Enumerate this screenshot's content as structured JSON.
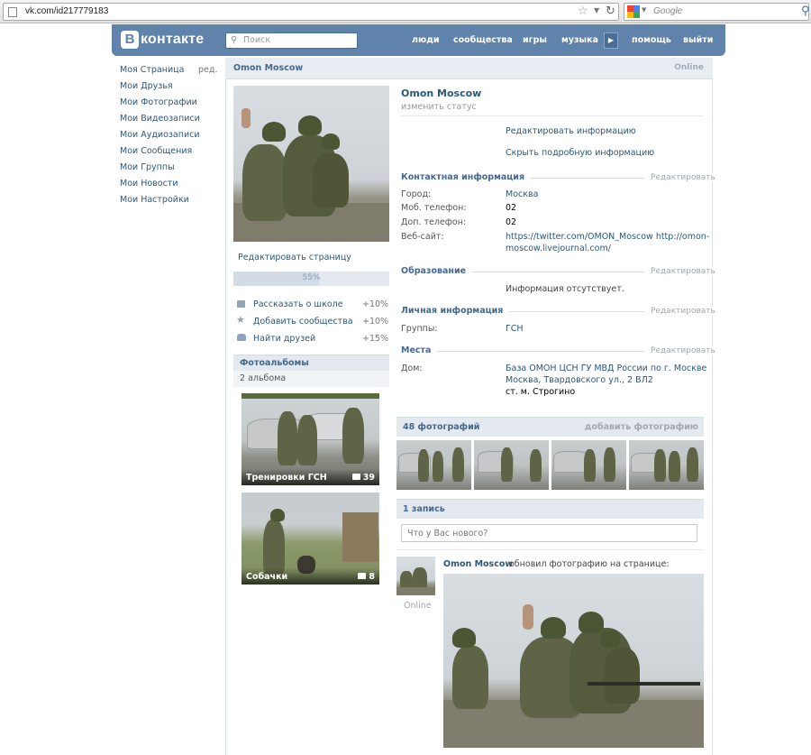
{
  "browser": {
    "url": "vk.com/id217779183",
    "search_placeholder": "Google"
  },
  "header": {
    "logo_letter": "В",
    "logo_text": "контакте",
    "search_placeholder": "Поиск",
    "nav": [
      "люди",
      "сообщества",
      "игры",
      "музыка",
      "помощь",
      "выйти"
    ]
  },
  "menu": {
    "edit_label": "ред.",
    "items": [
      "Моя Страница",
      "Мои Друзья",
      "Мои Фотографии",
      "Мои Видеозаписи",
      "Мои Аудиозаписи",
      "Мои Сообщения",
      "Мои Группы",
      "Мои Новости",
      "Мои Настройки"
    ]
  },
  "profile_bar": {
    "name": "Omon Moscow",
    "status": "Online"
  },
  "left_column": {
    "edit_page": "Редактировать страницу",
    "progress": {
      "value": 0.55,
      "label": "55%"
    },
    "suggestions": [
      {
        "icon": "school-icon",
        "label": "Рассказать о школе",
        "bonus": "+10%"
      },
      {
        "icon": "star-icon",
        "label": "Добавить сообщества",
        "bonus": "+10%"
      },
      {
        "icon": "friends-icon",
        "label": "Найти друзей",
        "bonus": "+15%"
      }
    ],
    "albums_title": "Фотоальбомы",
    "albums_count": "2 альбома",
    "albums": [
      {
        "title": "Тренировки ГСН",
        "count": "39"
      },
      {
        "title": "Собачки",
        "count": "8"
      }
    ]
  },
  "info": {
    "name": "Omon Moscow",
    "change_status": "изменить статус",
    "edit_info": "Редактировать информацию",
    "hide_info": "Скрыть подробную информацию",
    "edit_label": "Редактировать",
    "contacts": {
      "title": "Контактная информация",
      "rows": [
        {
          "label": "Город:",
          "value": "Москва"
        },
        {
          "label": "Моб. телефон:",
          "value": "02"
        },
        {
          "label": "Доп. телефон:",
          "value": "02"
        },
        {
          "label": "Веб-сайт:",
          "value_line1": "https://twitter.com/OMON_Moscow http://omon-",
          "value_line2": "moscow.livejournal.com/"
        }
      ]
    },
    "education": {
      "title": "Образование",
      "value": "Информация отсутствует."
    },
    "personal": {
      "title": "Личная информация",
      "label": "Группы:",
      "value": "ГСН"
    },
    "places": {
      "title": "Места",
      "label": "Дом:",
      "line1": "База ОМОН ЦСН ГУ МВД России по г. Москве",
      "line2": "Москва, Твардовского ул., 2 ВЛ2",
      "line3": "ст. м. Строгино"
    }
  },
  "photos": {
    "title": "48 фотографий",
    "add_label": "добавить фотографию"
  },
  "wall": {
    "title": "1 запись",
    "composer_placeholder": "Что у Вас нового?",
    "post": {
      "author": "Omon Moscow",
      "action": "обновил фотографию на странице:",
      "status": "Online"
    }
  }
}
